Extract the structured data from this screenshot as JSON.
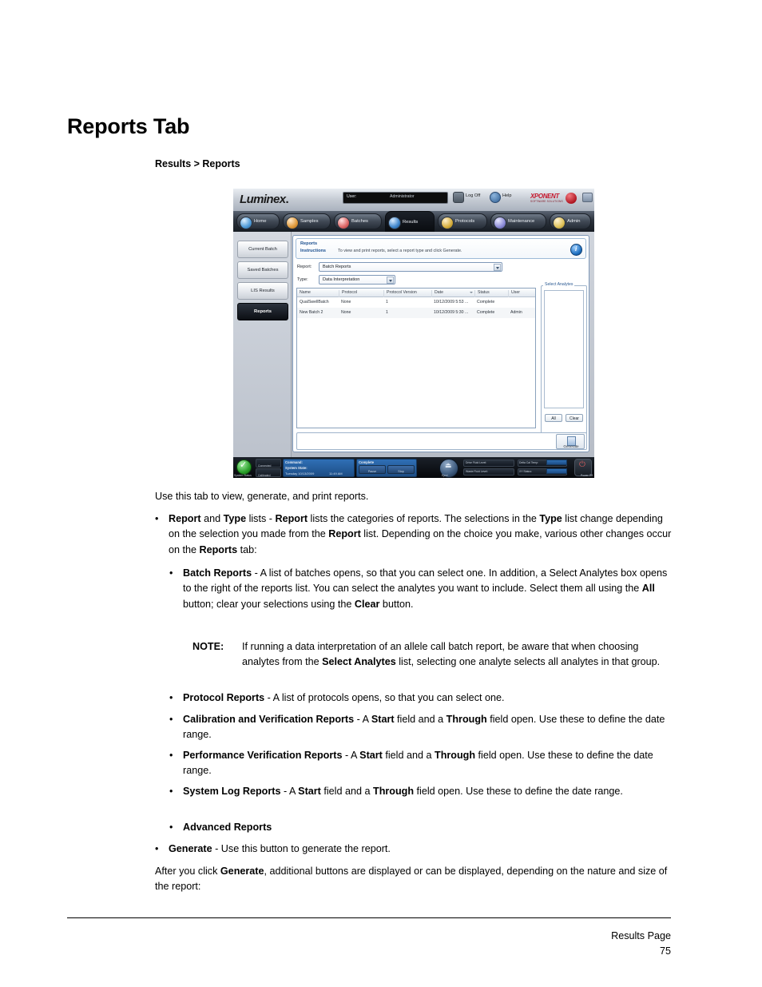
{
  "document": {
    "title": "Reports Tab",
    "breadcrumb": "Results > Reports",
    "intro": "Use this tab to view, generate, and print reports.",
    "after_generate": "the nature and size of the report:",
    "footer": {
      "label": "Results Page",
      "page_number": "75"
    }
  },
  "bullets": {
    "report_type_lists": {
      "marker": "•",
      "lead_a": "Report",
      "mid_a": " and ",
      "lead_b": "Type",
      "rest": " lists - ",
      "lead_c": "Report",
      "body1": " lists the categories of reports. The selections in the ",
      "lead_d": "Type",
      "body2": " list change depending on the selection you made from the ",
      "lead_e": "Report",
      "body3": " list. Depending on the choice you make, various other changes occur on the ",
      "lead_f": "Reports",
      "body4": " tab:"
    },
    "batch_reports": {
      "marker": "•",
      "title": "Batch Reports",
      "body1": " - A list of batches opens, so that you can select one. In addition, a Select Analytes box opens to the right of the reports list. You can select the analytes you want to include. Select them all using the ",
      "bold_all": "All",
      "body2": " button; clear your selections using the ",
      "bold_clear": "Clear",
      "body3": " button."
    },
    "note": {
      "label": "NOTE:",
      "body1": "If running a data interpretation of an allele call batch report, be aware that when choosing analytes from the ",
      "bold": "Select Analytes",
      "body2": " list, selecting one analyte selects all analytes in that group."
    },
    "protocol_reports": {
      "marker": "•",
      "title": "Protocol Reports",
      "body": " - A list of protocols opens, so that you can select one."
    },
    "calibration_reports": {
      "marker": "•",
      "title": "Calibration and Verification Reports",
      "body1": " - A ",
      "bold_start": "Start",
      "body2": " field and a ",
      "bold_through": "Through",
      "body3": " field open. Use these to define the date range."
    },
    "performance_reports": {
      "marker": "•",
      "title": "Performance Verification Reports",
      "body1": " - A ",
      "bold_start": "Start",
      "body2": " field and a ",
      "bold_through": "Through",
      "body3": " field open. Use these to define the date range."
    },
    "system_log_reports": {
      "marker": "•",
      "title": "System Log Reports",
      "body1": " - A ",
      "bold_start": "Start",
      "body2": " field and a ",
      "bold_through": "Through",
      "body3": " field open. Use these to define the date range."
    },
    "advanced_reports": {
      "marker": "•",
      "title": "Advanced Reports"
    },
    "generate": {
      "marker": "•",
      "title": "Generate",
      "body": " - Use this button to generate the report."
    },
    "after_generate": {
      "pre": "After you click ",
      "bold": "Generate",
      "post": ", additional buttons are displayed or can be displayed, depending on the nature and size of the report:"
    }
  },
  "app": {
    "brand": "Luminex",
    "brand_dot": ".",
    "titlebar": {
      "user_label": "User:",
      "user_value": "Administrator",
      "log_off": "Log Off",
      "help": "Help",
      "xponent": "XPONENT",
      "xponent_sub": "SOFTWARE SOLUTIONS"
    },
    "nav_tabs": [
      {
        "label": "Home",
        "active": false
      },
      {
        "label": "Samples",
        "active": false
      },
      {
        "label": "Batches",
        "active": false
      },
      {
        "label": "Results",
        "active": true
      },
      {
        "label": "Protocols",
        "active": false
      },
      {
        "label": "Maintenance",
        "active": false
      },
      {
        "label": "Admin",
        "active": false
      }
    ],
    "sidebar": [
      {
        "label": "Current Batch",
        "active": false
      },
      {
        "label": "Saved Batches",
        "active": false
      },
      {
        "label": "LIS Results",
        "active": false
      },
      {
        "label": "Reports",
        "active": true
      }
    ],
    "instructions": {
      "line1": "Reports",
      "line2": "Instructions",
      "text": "To view and print reports, select a report type and click Generate."
    },
    "form": {
      "report_label": "Report:",
      "report_value": "Batch Reports",
      "type_label": "Type:",
      "type_value": "Data Interpretation"
    },
    "grid": {
      "columns": [
        "Name",
        "Protocol",
        "Protocol Version",
        "Date",
        "Status",
        "User"
      ],
      "rows": [
        {
          "name": "QualSwellBatch",
          "protocol": "None",
          "protocol_version": "1",
          "date": "10/12/2009 5:53 ...",
          "status": "Complete",
          "user": ""
        },
        {
          "name": "New Batch 2",
          "protocol": "None",
          "protocol_version": "1",
          "date": "10/12/2009 5:30 ...",
          "status": "Complete",
          "user": "Admin"
        }
      ]
    },
    "analytes": {
      "title": "Select Analytes",
      "all_button": "All",
      "clear_button": "Clear"
    },
    "generate_button": "Generate",
    "status_bar": {
      "system_status": "System Status",
      "connected": "Connected",
      "calibrated": "Calibrated",
      "command_label": "Command:",
      "system_state_label": "System State:",
      "date": "Tuesday 10/13/2009",
      "time": "11:49 AM",
      "progress_label": "Complete",
      "pause": "Pause",
      "stop": "Stop",
      "eject": "Eject",
      "drive_fluid_level": "Drive Fluid Level:",
      "waste_fluid_level": "Waste Fluid Level:",
      "delta_cal_temp": "Delta Cal Temp:",
      "xy_status": "XY Status:",
      "power_off": "Power Off"
    }
  }
}
